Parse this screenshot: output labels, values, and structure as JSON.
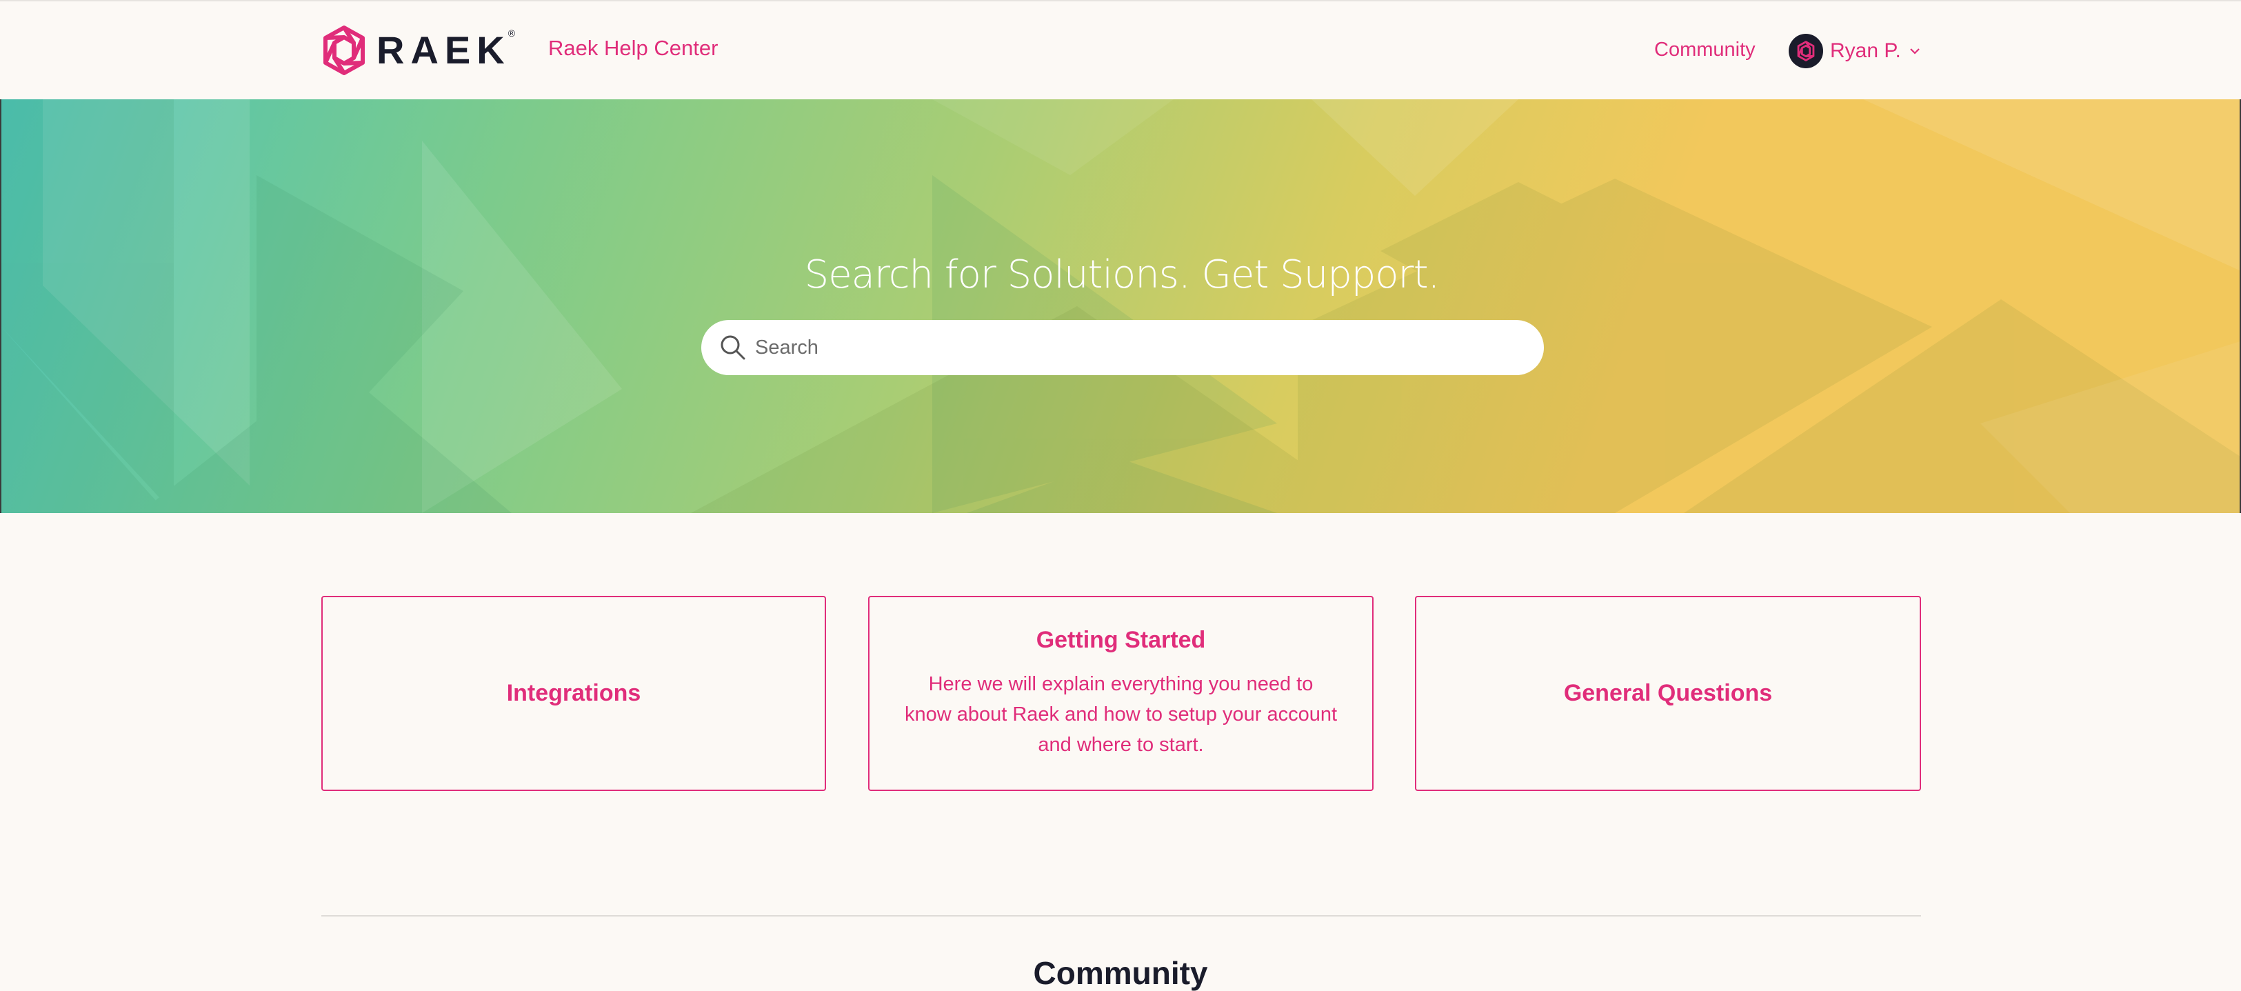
{
  "header": {
    "logo_text": "RAEK",
    "logo_registered": "®",
    "help_center_label": "Raek Help Center",
    "community_label": "Community",
    "user_name": "Ryan P."
  },
  "hero": {
    "title": "Search for Solutions. Get Support.",
    "search_placeholder": "Search"
  },
  "categories": [
    {
      "title": "Integrations",
      "description": ""
    },
    {
      "title": "Getting Started",
      "description": "Here we will explain everything you need to know about Raek and how to setup your account and where to start."
    },
    {
      "title": "General Questions",
      "description": ""
    }
  ],
  "section": {
    "heading": "Community"
  },
  "colors": {
    "accent": "#e02d7a",
    "dark": "#1a1c2b",
    "background": "#fcf9f5"
  },
  "icons": [
    "raek-logo-icon",
    "avatar-icon",
    "chevron-down-icon",
    "search-icon"
  ]
}
